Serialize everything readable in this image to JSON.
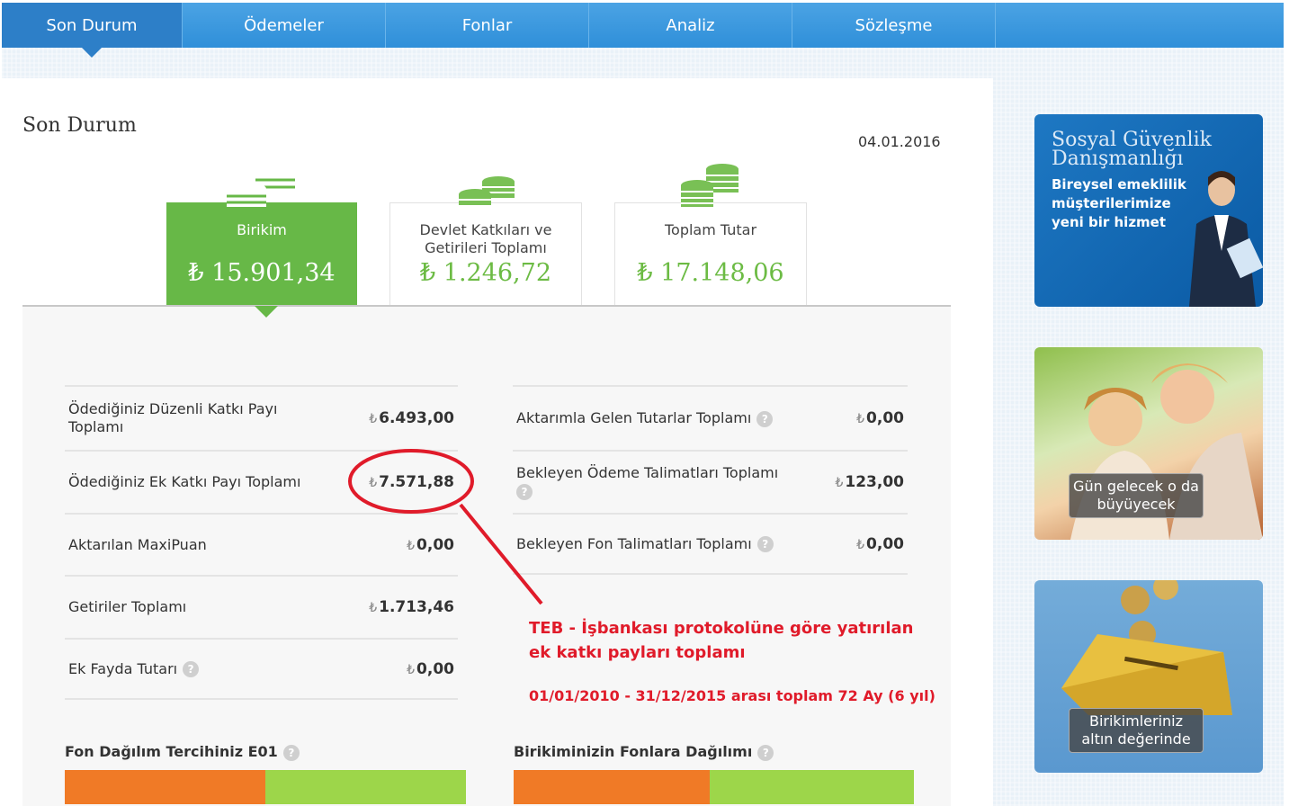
{
  "nav": {
    "tabs": [
      {
        "label": "Son Durum",
        "active": true
      },
      {
        "label": "Ödemeler"
      },
      {
        "label": "Fonlar"
      },
      {
        "label": "Analiz"
      },
      {
        "label": "Sözleşme"
      }
    ]
  },
  "page": {
    "title": "Son Durum",
    "date": "04.01.2016"
  },
  "summary": {
    "cards": [
      {
        "label": "Birikim",
        "value": "15.901,34",
        "currency": "₺"
      },
      {
        "label": "Devlet Katkıları ve Getirileri Toplamı",
        "value": "1.246,72",
        "currency": "₺"
      },
      {
        "label": "Toplam Tutar",
        "value": "17.148,06",
        "currency": "₺"
      }
    ]
  },
  "left_rows": [
    {
      "label": "Ödediğiniz Düzenli Katkı Payı Toplamı",
      "value": "6.493,00",
      "currency": "₺"
    },
    {
      "label": "Ödediğiniz Ek Katkı Payı Toplamı",
      "value": "7.571,88",
      "currency": "₺"
    },
    {
      "label": "Aktarılan MaxiPuan",
      "value": "0,00",
      "currency": "₺"
    },
    {
      "label": "Getiriler Toplamı",
      "value": "1.713,46",
      "currency": "₺"
    },
    {
      "label": "Ek Fayda Tutarı",
      "value": "0,00",
      "currency": "₺",
      "help": true
    }
  ],
  "right_rows": [
    {
      "label": "Aktarımla Gelen Tutarlar Toplamı",
      "value": "0,00",
      "currency": "₺",
      "help": true
    },
    {
      "label": "Bekleyen Ödeme Talimatları Toplamı",
      "value": "123,00",
      "currency": "₺",
      "help": true
    },
    {
      "label": "Bekleyen Fon Talimatları Toplamı",
      "value": "0,00",
      "currency": "₺",
      "help": true
    }
  ],
  "sections": {
    "fund_pref": {
      "title": "Fon Dağılım Tercihiniz E01",
      "orange_share": 0.5
    },
    "fund_dist": {
      "title": "Birikiminizin Fonlara Dağılımı",
      "orange_share": 0.49
    }
  },
  "annotation": {
    "main": "TEB - İşbankası protokolüne göre yatırılan ek katkı payları toplamı",
    "period": "01/01/2010 - 31/12/2015 arası toplam 72 Ay (6 yıl)",
    "color": "#e01b2a"
  },
  "help_glyph": "?",
  "ads": {
    "ad1": {
      "title": "Sosyal Güvenlik Danışmanlığı",
      "text": "Bireysel emeklilik müşterilerimize yeni bir hizmet"
    },
    "ad2": {
      "caption": "Gün gelecek o da büyüyecek"
    },
    "ad3": {
      "caption": "Birikimleriniz altın değerinde"
    }
  },
  "colors": {
    "nav": "#3a97de",
    "accent_green": "#67b847",
    "value_green": "#6cbb44",
    "bar_orange": "#f07a26",
    "bar_green": "#9dd64a"
  }
}
